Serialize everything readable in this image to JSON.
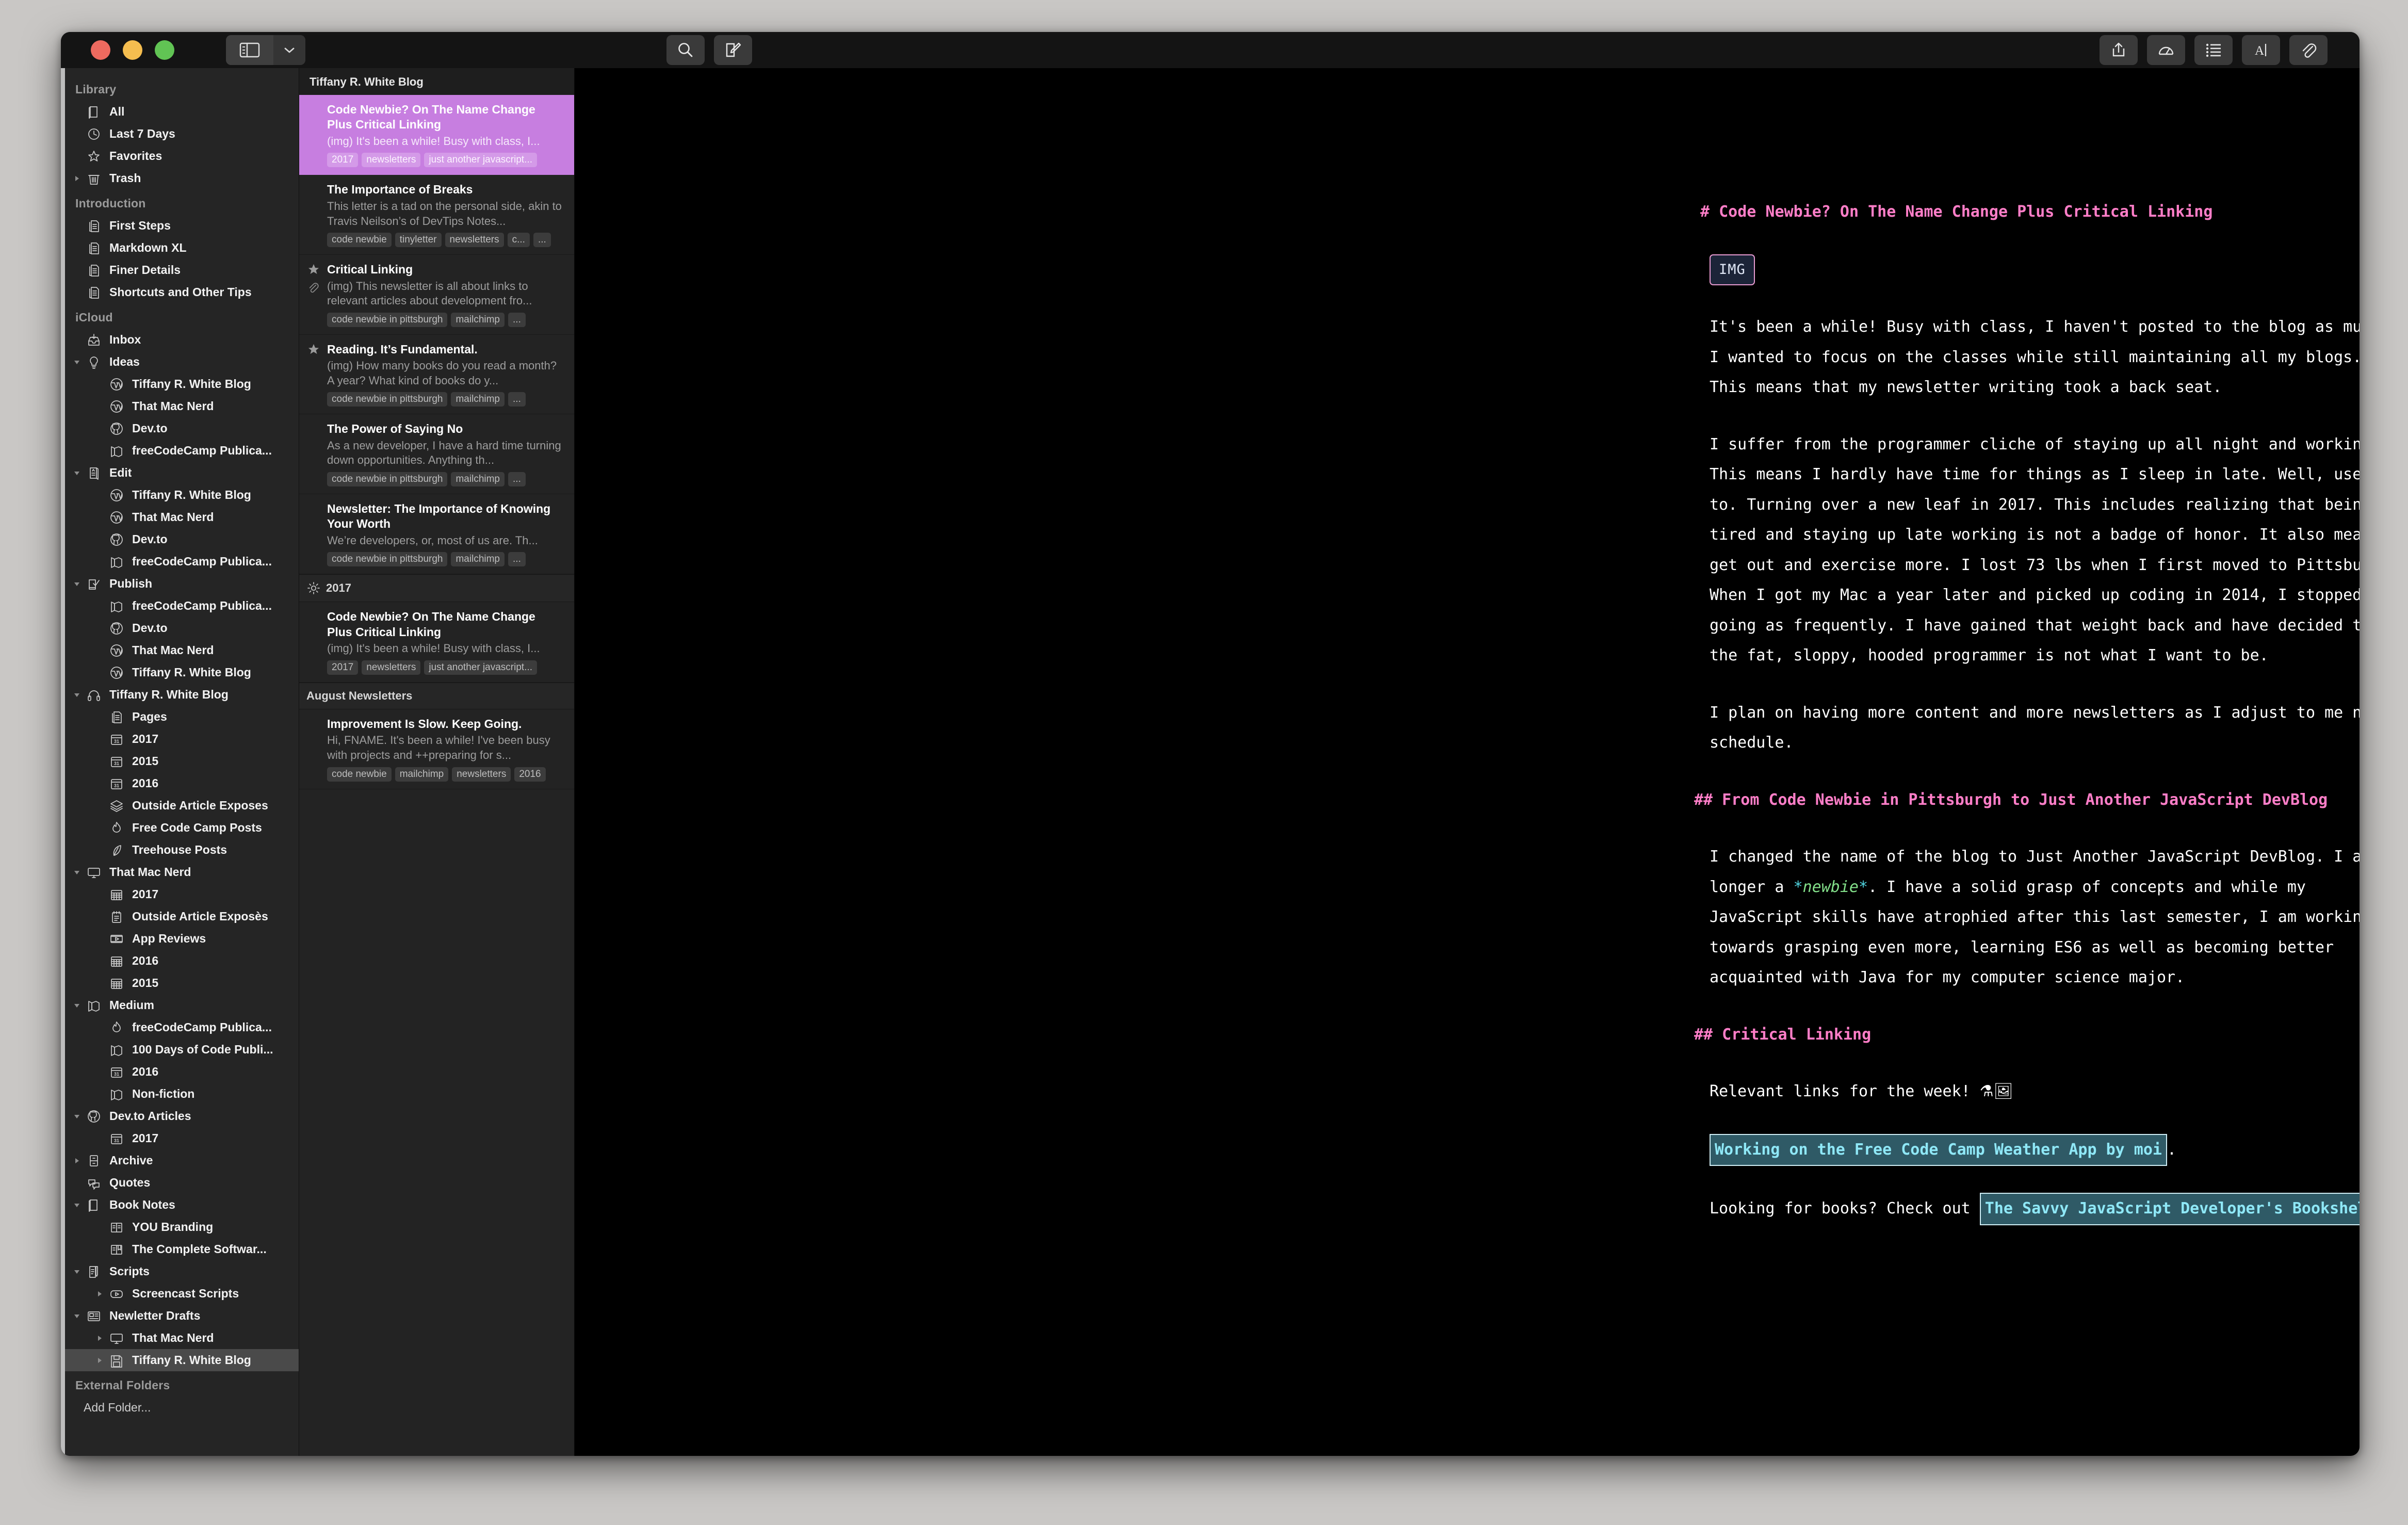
{
  "window": {
    "traffic_lights": [
      "close",
      "minimize",
      "zoom"
    ],
    "toolbar_left": [
      {
        "name": "sidebar-toggle",
        "icon": "sidebar-icon"
      },
      {
        "name": "sidebar-dropdown",
        "icon": "chevron-down-icon"
      }
    ],
    "toolbar_mid": [
      {
        "name": "search",
        "icon": "search-icon"
      },
      {
        "name": "new-sheet",
        "icon": "compose-icon"
      }
    ],
    "toolbar_right": [
      {
        "name": "share",
        "icon": "share-icon"
      },
      {
        "name": "statistics",
        "icon": "gauge-icon"
      },
      {
        "name": "navigation",
        "icon": "list-icon"
      },
      {
        "name": "markup",
        "icon": "text-format-icon"
      },
      {
        "name": "attachments",
        "icon": "paperclip-icon"
      }
    ]
  },
  "sidebar": {
    "sections": [
      {
        "header": "Library",
        "items": [
          {
            "label": "All",
            "icon": "book-icon",
            "depth": 1,
            "twisty": ""
          },
          {
            "label": "Last 7 Days",
            "icon": "clock-icon",
            "depth": 1,
            "twisty": ""
          },
          {
            "label": "Favorites",
            "icon": "star-icon",
            "depth": 1,
            "twisty": ""
          },
          {
            "label": "Trash",
            "icon": "trash-icon",
            "depth": 1,
            "twisty": "collapsed"
          }
        ]
      },
      {
        "header": "Introduction",
        "items": [
          {
            "label": "First Steps",
            "icon": "document-icon",
            "depth": 1,
            "twisty": ""
          },
          {
            "label": "Markdown XL",
            "icon": "document-icon",
            "depth": 1,
            "twisty": ""
          },
          {
            "label": "Finer Details",
            "icon": "document-icon",
            "depth": 1,
            "twisty": ""
          },
          {
            "label": "Shortcuts and Other Tips",
            "icon": "document-icon",
            "depth": 1,
            "twisty": ""
          }
        ]
      },
      {
        "header": "iCloud",
        "items": [
          {
            "label": "Inbox",
            "icon": "inbox-icon",
            "depth": 1,
            "twisty": ""
          },
          {
            "label": "Ideas",
            "icon": "lightbulb-icon",
            "depth": 1,
            "twisty": "expanded"
          },
          {
            "label": "Tiffany R. White Blog",
            "icon": "wordpress-icon",
            "depth": 2,
            "twisty": ""
          },
          {
            "label": "That Mac Nerd",
            "icon": "wordpress-icon",
            "depth": 2,
            "twisty": ""
          },
          {
            "label": "Dev.to",
            "icon": "github-icon",
            "depth": 2,
            "twisty": ""
          },
          {
            "label": "freeCodeCamp Publica...",
            "icon": "medium-icon",
            "depth": 2,
            "twisty": ""
          },
          {
            "label": "Edit",
            "icon": "edit-doc-icon",
            "depth": 1,
            "twisty": "expanded"
          },
          {
            "label": "Tiffany R. White Blog",
            "icon": "wordpress-icon",
            "depth": 2,
            "twisty": ""
          },
          {
            "label": "That Mac Nerd",
            "icon": "wordpress-icon",
            "depth": 2,
            "twisty": ""
          },
          {
            "label": "Dev.to",
            "icon": "github-icon",
            "depth": 2,
            "twisty": ""
          },
          {
            "label": "freeCodeCamp Publica...",
            "icon": "medium-icon",
            "depth": 2,
            "twisty": ""
          },
          {
            "label": "Publish",
            "icon": "publish-icon",
            "depth": 1,
            "twisty": "expanded"
          },
          {
            "label": "freeCodeCamp Publica...",
            "icon": "medium-icon",
            "depth": 2,
            "twisty": ""
          },
          {
            "label": "Dev.to",
            "icon": "github-icon",
            "depth": 2,
            "twisty": ""
          },
          {
            "label": "That Mac Nerd",
            "icon": "wordpress-icon",
            "depth": 2,
            "twisty": ""
          },
          {
            "label": "Tiffany R. White Blog",
            "icon": "wordpress-icon",
            "depth": 2,
            "twisty": ""
          },
          {
            "label": "Tiffany R. White Blog",
            "icon": "headphones-icon",
            "depth": 1,
            "twisty": "expanded"
          },
          {
            "label": "Pages",
            "icon": "document-icon",
            "depth": 2,
            "twisty": ""
          },
          {
            "label": "2017",
            "icon": "calendar31-icon",
            "depth": 2,
            "twisty": ""
          },
          {
            "label": "2015",
            "icon": "calendar31-icon",
            "depth": 2,
            "twisty": ""
          },
          {
            "label": "2016",
            "icon": "calendar31-icon",
            "depth": 2,
            "twisty": ""
          },
          {
            "label": "Outside Article Exposes",
            "icon": "layers-icon",
            "depth": 2,
            "twisty": ""
          },
          {
            "label": "Free Code Camp Posts",
            "icon": "flame-icon",
            "depth": 2,
            "twisty": ""
          },
          {
            "label": "Treehouse Posts",
            "icon": "leaf-icon",
            "depth": 2,
            "twisty": ""
          },
          {
            "label": "That Mac Nerd",
            "icon": "display-icon",
            "depth": 1,
            "twisty": "expanded"
          },
          {
            "label": "2017",
            "icon": "calendar-grid-icon",
            "depth": 2,
            "twisty": ""
          },
          {
            "label": "Outside Article Exposès",
            "icon": "notepad-icon",
            "depth": 2,
            "twisty": ""
          },
          {
            "label": "App Reviews",
            "icon": "video-icon",
            "depth": 2,
            "twisty": ""
          },
          {
            "label": "2016",
            "icon": "calendar-grid-icon",
            "depth": 2,
            "twisty": ""
          },
          {
            "label": "2015",
            "icon": "calendar-grid-icon",
            "depth": 2,
            "twisty": ""
          },
          {
            "label": "Medium",
            "icon": "medium-icon",
            "depth": 1,
            "twisty": "expanded"
          },
          {
            "label": "freeCodeCamp Publica...",
            "icon": "flame-icon",
            "depth": 2,
            "twisty": ""
          },
          {
            "label": "100 Days of Code Publi...",
            "icon": "medium-icon",
            "depth": 2,
            "twisty": ""
          },
          {
            "label": "2016",
            "icon": "calendar31-icon",
            "depth": 2,
            "twisty": ""
          },
          {
            "label": "Non-fiction",
            "icon": "medium-icon",
            "depth": 2,
            "twisty": ""
          },
          {
            "label": "Dev.to Articles",
            "icon": "github-icon",
            "depth": 1,
            "twisty": "expanded"
          },
          {
            "label": "2017",
            "icon": "calendar31-icon",
            "depth": 2,
            "twisty": ""
          },
          {
            "label": "Archive",
            "icon": "cabinet-icon",
            "depth": 1,
            "twisty": "collapsed"
          },
          {
            "label": "Quotes",
            "icon": "quotes-icon",
            "depth": 1,
            "twisty": ""
          },
          {
            "label": "Book Notes",
            "icon": "book-icon",
            "depth": 1,
            "twisty": "expanded"
          },
          {
            "label": "YOU Branding",
            "icon": "open-book-icon",
            "depth": 2,
            "twisty": ""
          },
          {
            "label": "The Complete Softwar...",
            "icon": "bookmark-book-icon",
            "depth": 2,
            "twisty": ""
          },
          {
            "label": "Scripts",
            "icon": "script-icon",
            "depth": 1,
            "twisty": "expanded"
          },
          {
            "label": "Screencast Scripts",
            "icon": "play-icon",
            "depth": 2,
            "twisty": "collapsed"
          },
          {
            "label": "Newletter Drafts",
            "icon": "newspaper-icon",
            "depth": 1,
            "twisty": "expanded"
          },
          {
            "label": "That Mac Nerd",
            "icon": "display-icon",
            "depth": 2,
            "twisty": "collapsed"
          },
          {
            "label": "Tiffany R. White Blog",
            "icon": "floppy-icon",
            "depth": 2,
            "twisty": "collapsed",
            "selected": true
          }
        ]
      }
    ],
    "footer": {
      "header": "External Folders",
      "add_folder": "Add Folder..."
    }
  },
  "list": {
    "header": "Tiffany R. White Blog",
    "groups": [
      {
        "separator": null,
        "items": [
          {
            "title": "Code Newbie? On The Name Change Plus Critical Linking",
            "preview": "(img) It's been a while! Busy with class, I...",
            "tags": [
              "2017",
              "newsletters",
              "just another javascript..."
            ],
            "active": true,
            "starred": false,
            "attachment": false
          },
          {
            "title": "The Importance of Breaks",
            "preview": "This letter is a tad on the personal side, akin to Travis Neilson’s of DevTips Notes...",
            "tags": [
              "code newbie",
              "tinyletter",
              "newsletters",
              "c...",
              "..."
            ],
            "active": false,
            "starred": false,
            "attachment": false
          },
          {
            "title": "Critical Linking",
            "preview": "(img) This newsletter is all about links to relevant articles about development fro...",
            "tags": [
              "code newbie in pittsburgh",
              "mailchimp",
              "..."
            ],
            "active": false,
            "starred": true,
            "attachment": true
          },
          {
            "title": "Reading. It’s Fundamental.",
            "preview": "(img) How many books do you read a month? A year? What kind of books do y...",
            "tags": [
              "code newbie in pittsburgh",
              "mailchimp",
              "..."
            ],
            "active": false,
            "starred": true,
            "attachment": false
          },
          {
            "title": "The Power of Saying No",
            "preview": "As a new developer, I have a hard time turning down opportunities. Anything th...",
            "tags": [
              "code newbie in pittsburgh",
              "mailchimp",
              "..."
            ],
            "active": false,
            "starred": false,
            "attachment": false
          },
          {
            "title": "Newsletter: The Importance of Knowing Your Worth",
            "preview": "We’re developers, or, most of us are. Th...",
            "tags": [
              "code newbie in pittsburgh",
              "mailchimp",
              "..."
            ],
            "active": false,
            "starred": false,
            "attachment": false
          }
        ]
      },
      {
        "separator": "2017",
        "separator_icon": "gear-icon",
        "items": [
          {
            "title": "Code Newbie? On The Name Change Plus Critical Linking",
            "preview": "(img) It's been a while! Busy with class, I...",
            "tags": [
              "2017",
              "newsletters",
              "just another javascript..."
            ],
            "active": false,
            "starred": false,
            "attachment": false
          }
        ]
      },
      {
        "separator": "August Newsletters",
        "separator_icon": null,
        "items": [
          {
            "title": "Improvement Is Slow. Keep Going.",
            "preview": "Hi, FNAME. It's been a while! I've been busy with projects and ++preparing for s...",
            "tags": [
              "code newbie",
              "mailchimp",
              "newsletters",
              "2016"
            ],
            "active": false,
            "starred": false,
            "attachment": false
          }
        ]
      }
    ]
  },
  "editor": {
    "blocks": [
      {
        "num": "1",
        "type": "h1",
        "text": "# Code Newbie? On The Name Change Plus Critical Linking"
      },
      {
        "num": "2",
        "type": "img",
        "text": "IMG"
      },
      {
        "num": "3",
        "type": "p",
        "text": "It's been a while! Busy with class, I haven't posted to the blog as much. I wanted to focus on the classes while still maintaining all my blogs. This means that my newsletter writing took a back seat."
      },
      {
        "num": "4",
        "type": "p",
        "text": "I suffer from the programmer cliche of staying up all night and working. This means I hardly have time for things as I sleep in late. Well, used to. Turning over a new leaf in 2017. This includes realizing that being tired and staying up late working is not a badge of honor. It also means I get out and exercise more. I lost 73 lbs when I first moved to Pittsburgh. When I got my Mac a year later and picked up coding in 2014, I stopped going as frequently. I have gained that weight back and have decided that the fat, sloppy, hooded programmer is not what I want to be."
      },
      {
        "num": "5",
        "type": "p",
        "text": "I plan on having more content and more newsletters as I adjust to me new schedule."
      },
      {
        "num": "6",
        "type": "h2",
        "text": "## From Code Newbie in Pittsburgh to Just Another JavaScript DevBlog"
      },
      {
        "num": "7",
        "type": "p_em",
        "pre": "I changed the name of the blog to Just Another JavaScript DevBlog. I am no longer a ",
        "em": "newbie",
        "post": ". I have a solid grasp of concepts and while my JavaScript skills have atrophied after this last semester, I am working towards grasping even more, learning ES6 as well as becoming better acquainted with Java for my computer science major."
      },
      {
        "num": "8",
        "type": "h2",
        "text": "## Critical Linking"
      },
      {
        "num": "9",
        "type": "p_emoji",
        "text": "Relevant links for the week! ",
        "emoji": "⚗🖼"
      },
      {
        "num": "10",
        "type": "p_link",
        "pre": "",
        "link": "Working on the Free Code Camp Weather App by moi",
        "post": "."
      },
      {
        "num": "11",
        "type": "p_link",
        "pre": "Looking for books? Check out ",
        "link": "The Savvy JavaScript Developer's Bookshelf",
        "post": "."
      }
    ]
  }
}
